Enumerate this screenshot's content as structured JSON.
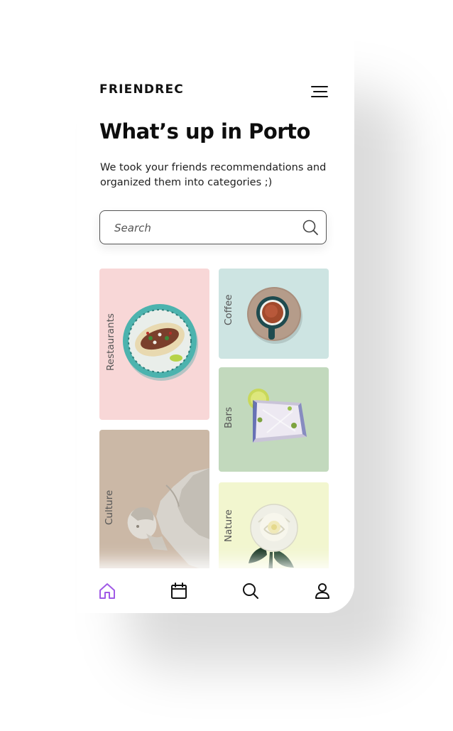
{
  "app": {
    "brand": "FRIENDREC"
  },
  "header": {
    "title": "What’s up in Porto",
    "subtitle": "We took your friends recommendations and organized them into categories ;)"
  },
  "search": {
    "placeholder": "Search",
    "value": ""
  },
  "categories": [
    {
      "label": "Restaurants",
      "color": "#f8d7d7",
      "icon": "food-plate-image"
    },
    {
      "label": "Coffee",
      "color": "#cde4e2",
      "icon": "coffee-cup-image"
    },
    {
      "label": "Bars",
      "color": "#c2d9bd",
      "icon": "cocktail-glass-image"
    },
    {
      "label": "Culture",
      "color": "#cbb8a6",
      "icon": "statue-image"
    },
    {
      "label": "Nature",
      "color": "#f2f6cf",
      "icon": "white-rose-image"
    }
  ],
  "bottom_nav": {
    "items": [
      {
        "icon": "home-icon",
        "active": true
      },
      {
        "icon": "calendar-icon",
        "active": false
      },
      {
        "icon": "search-icon",
        "active": false
      },
      {
        "icon": "profile-icon",
        "active": false
      }
    ],
    "active_color": "#a05ae6",
    "inactive_color": "#111111"
  }
}
